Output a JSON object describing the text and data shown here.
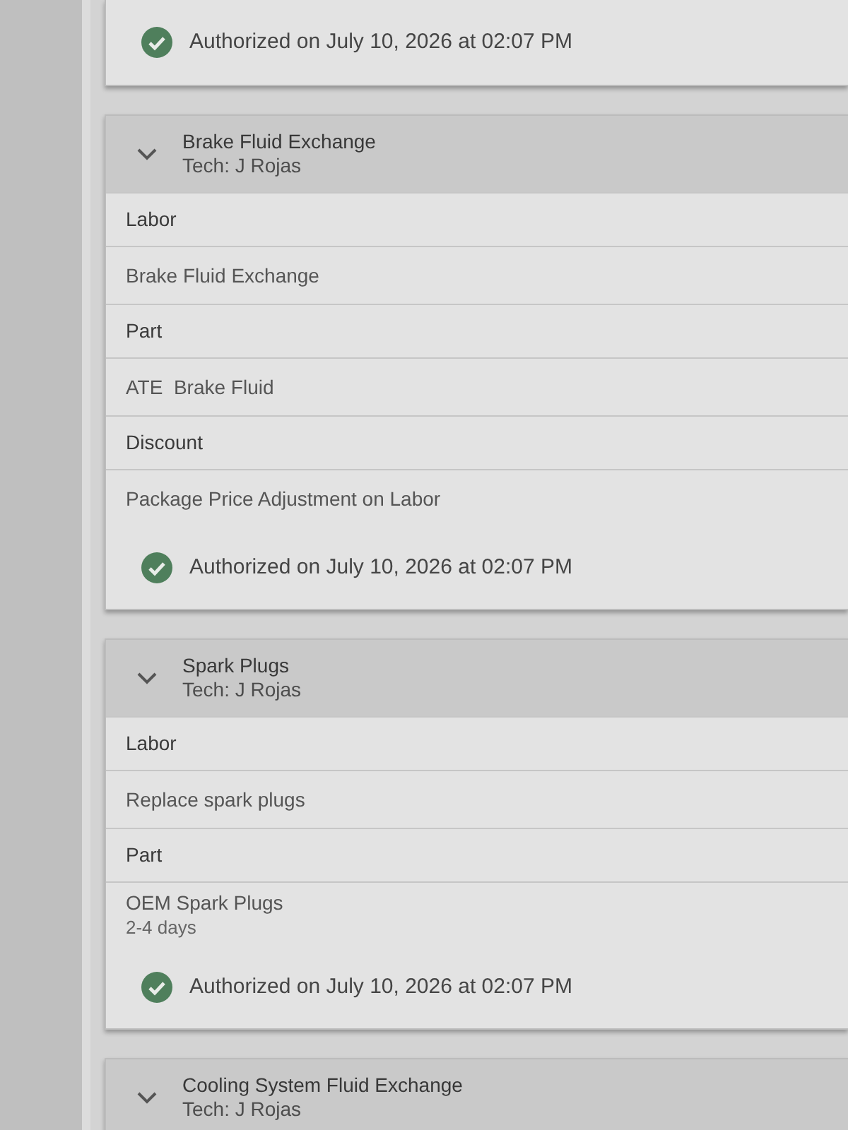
{
  "cards": [
    {
      "authorization": "Authorized on July 10, 2026 at 02:07 PM"
    },
    {
      "title": "Brake Fluid Exchange",
      "tech": "Tech: J Rojas",
      "expanded": true,
      "lines": [
        {
          "kind": "category",
          "text": "Labor"
        },
        {
          "kind": "item",
          "text": "Brake Fluid Exchange"
        },
        {
          "kind": "category",
          "text": "Part"
        },
        {
          "kind": "item",
          "text": "ATE  Brake Fluid"
        },
        {
          "kind": "category",
          "text": "Discount"
        },
        {
          "kind": "item",
          "text": "Package Price Adjustment on Labor"
        }
      ],
      "authorization": "Authorized on July 10, 2026 at 02:07 PM"
    },
    {
      "title": "Spark Plugs",
      "tech": "Tech: J Rojas",
      "expanded": true,
      "lines": [
        {
          "kind": "category",
          "text": "Labor"
        },
        {
          "kind": "item",
          "text": "Replace spark plugs"
        },
        {
          "kind": "category",
          "text": "Part"
        },
        {
          "kind": "item",
          "text": "OEM Spark Plugs",
          "note": "2-4 days"
        }
      ],
      "authorization": "Authorized on July 10, 2026 at 02:07 PM"
    },
    {
      "title": "Cooling System Fluid Exchange",
      "tech": "Tech: J Rojas",
      "expanded": true
    }
  ]
}
